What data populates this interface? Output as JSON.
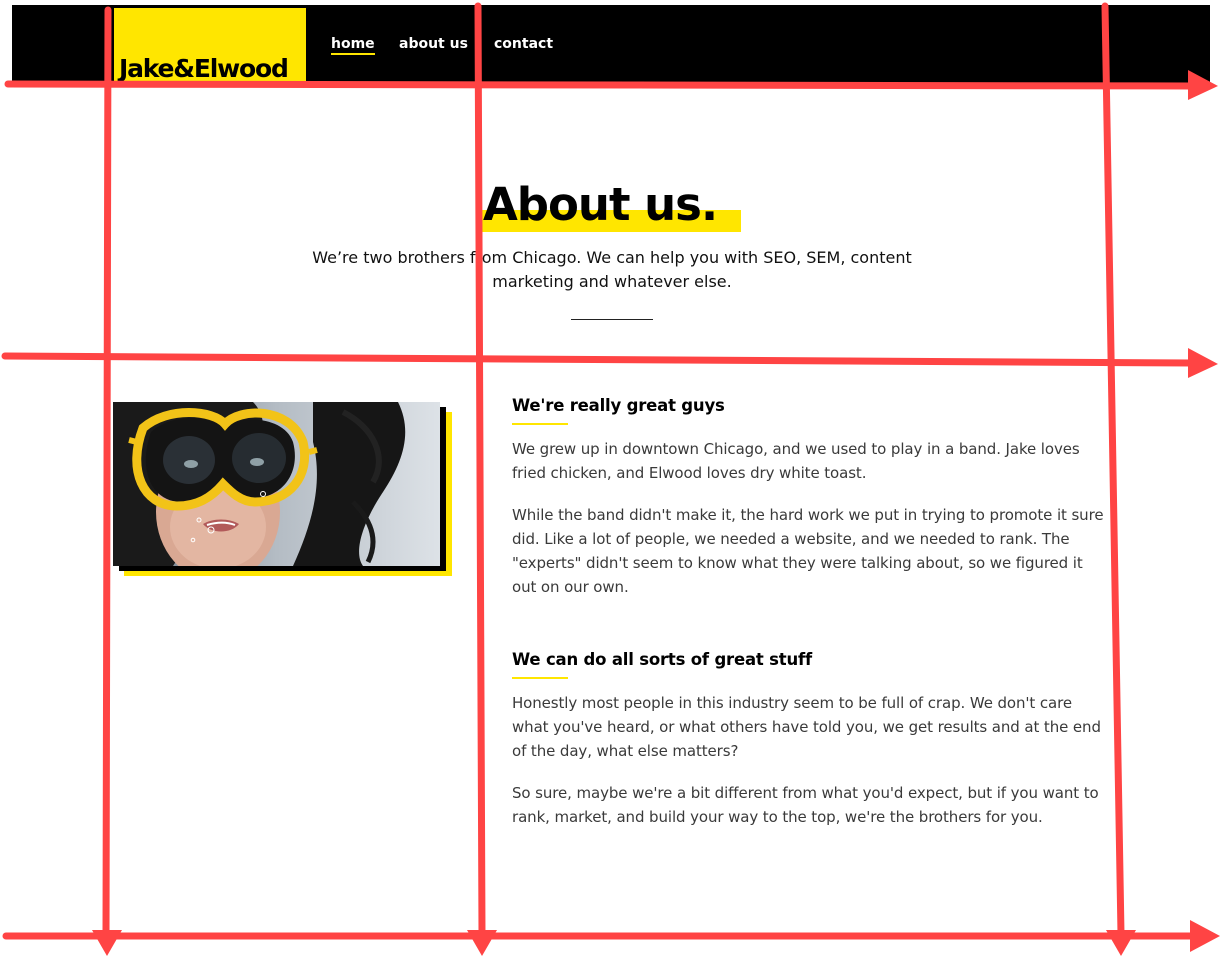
{
  "brand": {
    "name": "Jake&Elwood"
  },
  "nav": [
    {
      "label": "home",
      "active": true
    },
    {
      "label": "about us",
      "active": false
    },
    {
      "label": "contact",
      "active": false
    }
  ],
  "hero": {
    "title": "About us.",
    "subtitle": "We’re two brothers from Chicago. We can help you with SEO, SEM, content marketing and whatever else."
  },
  "sections": [
    {
      "heading": "We're really great guys",
      "paragraphs": [
        "We grew up in downtown Chicago, and we used to play in a band. Jake loves fried chicken, and Elwood loves dry white toast.",
        "While the band didn't make it, the hard work we put in trying to promote it sure did. Like a lot of people, we needed a website, and we needed to rank. The \"experts\" didn't seem to know what they were talking about, so we figured it out on our own."
      ]
    },
    {
      "heading": "We can do all sorts of great stuff",
      "paragraphs": [
        "Honestly most people in this industry seem to be full of crap. We don't care what you've heard, or what others have told you, we get results and at the end of the day, what else matters?",
        "So sure, maybe we're a bit different from what you'd expect, but if you want to rank, market, and build your way to the top, we're the brothers for you."
      ]
    }
  ],
  "colors": {
    "accent": "#ffe600",
    "header_bg": "#000000",
    "grid_overlay": "#ff4444"
  }
}
